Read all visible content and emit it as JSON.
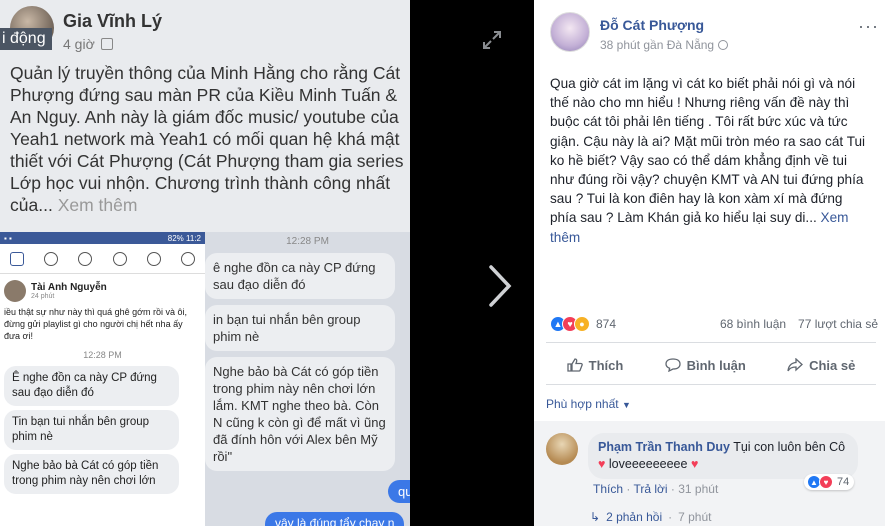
{
  "left_photo": {
    "top_post": {
      "author": "Gia Vĩnh Lý",
      "time": "4 giờ",
      "status_overlay": "i động",
      "body": "Quản lý truyền thông của Minh Hằng cho rằng Cát Phượng đứng sau màn PR của Kiều Minh Tuấn & An Nguy. Anh này là giám đốc music/ youtube của Yeah1 network mà Yeah1 có mối quan hệ khá mật thiết với Cát Phượng (Cát Phượng tham gia series Lớp học vui nhộn. Chương trình thành công nhất của...",
      "more": "Xem thêm"
    },
    "phone": {
      "status_text": "82% 11:2",
      "author": "Tài Anh Nguyễn",
      "time": "24 phút",
      "text": "iều thật sự như này thì quá ghê gớm rồi và ôi, đừng gửi playlist gì cho người chị hết nha ấy đưa ơi!",
      "chat_time": "12:28 PM",
      "bubbles": [
        "Ê nghe đồn ca này CP đứng sau đạo diễn đó",
        "Tin bạn tui nhắn bên group phim nè",
        "Nghe bảo bà Cát có góp tiền trong phim này nên chơi lớn"
      ]
    },
    "chat": {
      "time": "12:28 PM",
      "bubbles": [
        "ê nghe đồn ca này CP đứng sau đạo diễn đó",
        "in bạn tui nhắn bên group phim nè",
        "Nghe bảo bà Cát có góp tiền trong phim này nên chơi lớn lắm. KMT nghe theo bà. Còn N cũng k còn gì để mất vì ũng đã đính hôn với Alex bên Mỹ rồi\""
      ],
      "outgoing_1": "qu",
      "outgoing_2": "vậy là đúng tẩy chay n"
    }
  },
  "post": {
    "author": "Đỗ Cát Phượng",
    "meta": "38 phút gần Đà Nẵng",
    "text": "Qua giờ cát im lặng vì cát ko biết phải nói gì và nói thế nào cho mn hiểu ! Nhưng riêng vấn đề này thì buộc cát tôi phải lên tiếng . Tôi rất bức xúc và tức giận. Cậu này là ai? Mặt mũi tròn méo ra sao cát Tui ko hề biết? Vậy sao có thể dám khẳng định về tui như đúng rồi vậy? chuyện KMT và AN tui đứng phía sau ? Tui là kon điên hay là kon xàm xí mà đứng phía sau ? Làm Khán giả ko hiểu lại suy di...",
    "more": "Xem thêm",
    "reaction_count": "874",
    "comments_count": "68 bình luận",
    "shares_count": "77 lượt chia sẻ",
    "actions": {
      "like": "Thích",
      "comment": "Bình luận",
      "share": "Chia sẻ"
    },
    "sort": "Phù hợp nhất",
    "comment": {
      "author": "Phạm Trần Thanh Duy",
      "text_1": "Tụi con luôn bên Cô",
      "text_2": "loveeeeeeeee",
      "reaction_count": "74",
      "like": "Thích",
      "reply": "Trả lời",
      "time": "31 phút",
      "replies": "2 phản hồi",
      "replies_time": "7 phút"
    }
  }
}
